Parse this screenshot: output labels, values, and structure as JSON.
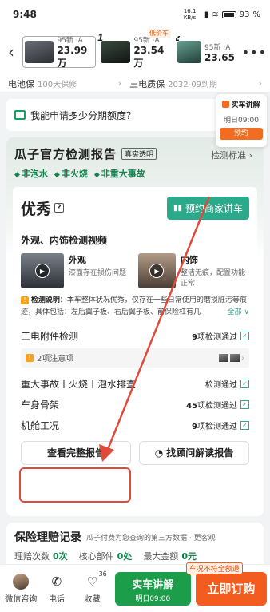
{
  "status": {
    "time": "9:48",
    "speed": "16.1 KB/s",
    "battery": "93"
  },
  "cars": [
    {
      "idx": "",
      "sub": "95新 ·A",
      "price": "23.99万",
      "tag": ""
    },
    {
      "idx": "1",
      "sub": "95新 ·A",
      "price": "23.54万",
      "tag": "低价车"
    },
    {
      "idx": "2",
      "sub": "95新 ·A",
      "price": "23.65",
      "tag": ""
    }
  ],
  "warranty": {
    "battery_label": "电池保",
    "battery_value": "100天保修",
    "tri_label": "三电质保",
    "tri_value": "2032-09到期"
  },
  "installment": "我能申请多少分期额度？",
  "consult": {
    "title": "实车讲解",
    "date": "明日09:00",
    "button": "预约"
  },
  "report": {
    "title": "瓜子官方检测报告",
    "tag": "真实透明",
    "standard": "检测标准 ›",
    "checks": [
      "非泡水",
      "非火烧",
      "非重大事故"
    ],
    "grade": "优秀",
    "book_button": "预约商家讲车",
    "video_section": "外观、内饰检测视频",
    "videos": [
      {
        "title": "外观",
        "desc": "漆面存在损伤问题"
      },
      {
        "title": "内饰",
        "desc": "整洁无痕，配置功能正常"
      }
    ],
    "explain_label": "检测说明：",
    "explain_text": "本车整体状况优秀，仅存在一些日常使用的磨损脏污等痕迹，具体包括：左后翼子板、右后翼子板、前保险杠有几",
    "explain_more": "全部 ∨",
    "items": [
      {
        "name": "三电附件检测",
        "count": "9",
        "suffix": "项检测通过"
      },
      {
        "name": "重大事故丨火烧丨泡水排查",
        "count": "",
        "suffix": "检测通过"
      },
      {
        "name": "车身骨架",
        "count": "45",
        "suffix": "项检测通过"
      },
      {
        "name": "机舱工况",
        "count": "9",
        "suffix": "项检测通过"
      }
    ],
    "notice": "2项注意项",
    "view_full": "查看完整报告",
    "consultant": "找顾问解读报告"
  },
  "insurance": {
    "title": "保险理赔记录",
    "sub": "瓜子付费为您查询的第三方数据 · 更客观",
    "claims_label": "理赔次数",
    "claims": "0次",
    "core_label": "核心部件",
    "core": "0处",
    "max_label": "最大金额",
    "max": "0元"
  },
  "bottom": {
    "wechat": "微信咨询",
    "phone": "电话",
    "fav": "收藏",
    "fav_count": "36",
    "explain_main": "实车讲解",
    "explain_date": "明日09:00",
    "buy": "立即订购",
    "buy_tag": "车况不符全额退"
  }
}
